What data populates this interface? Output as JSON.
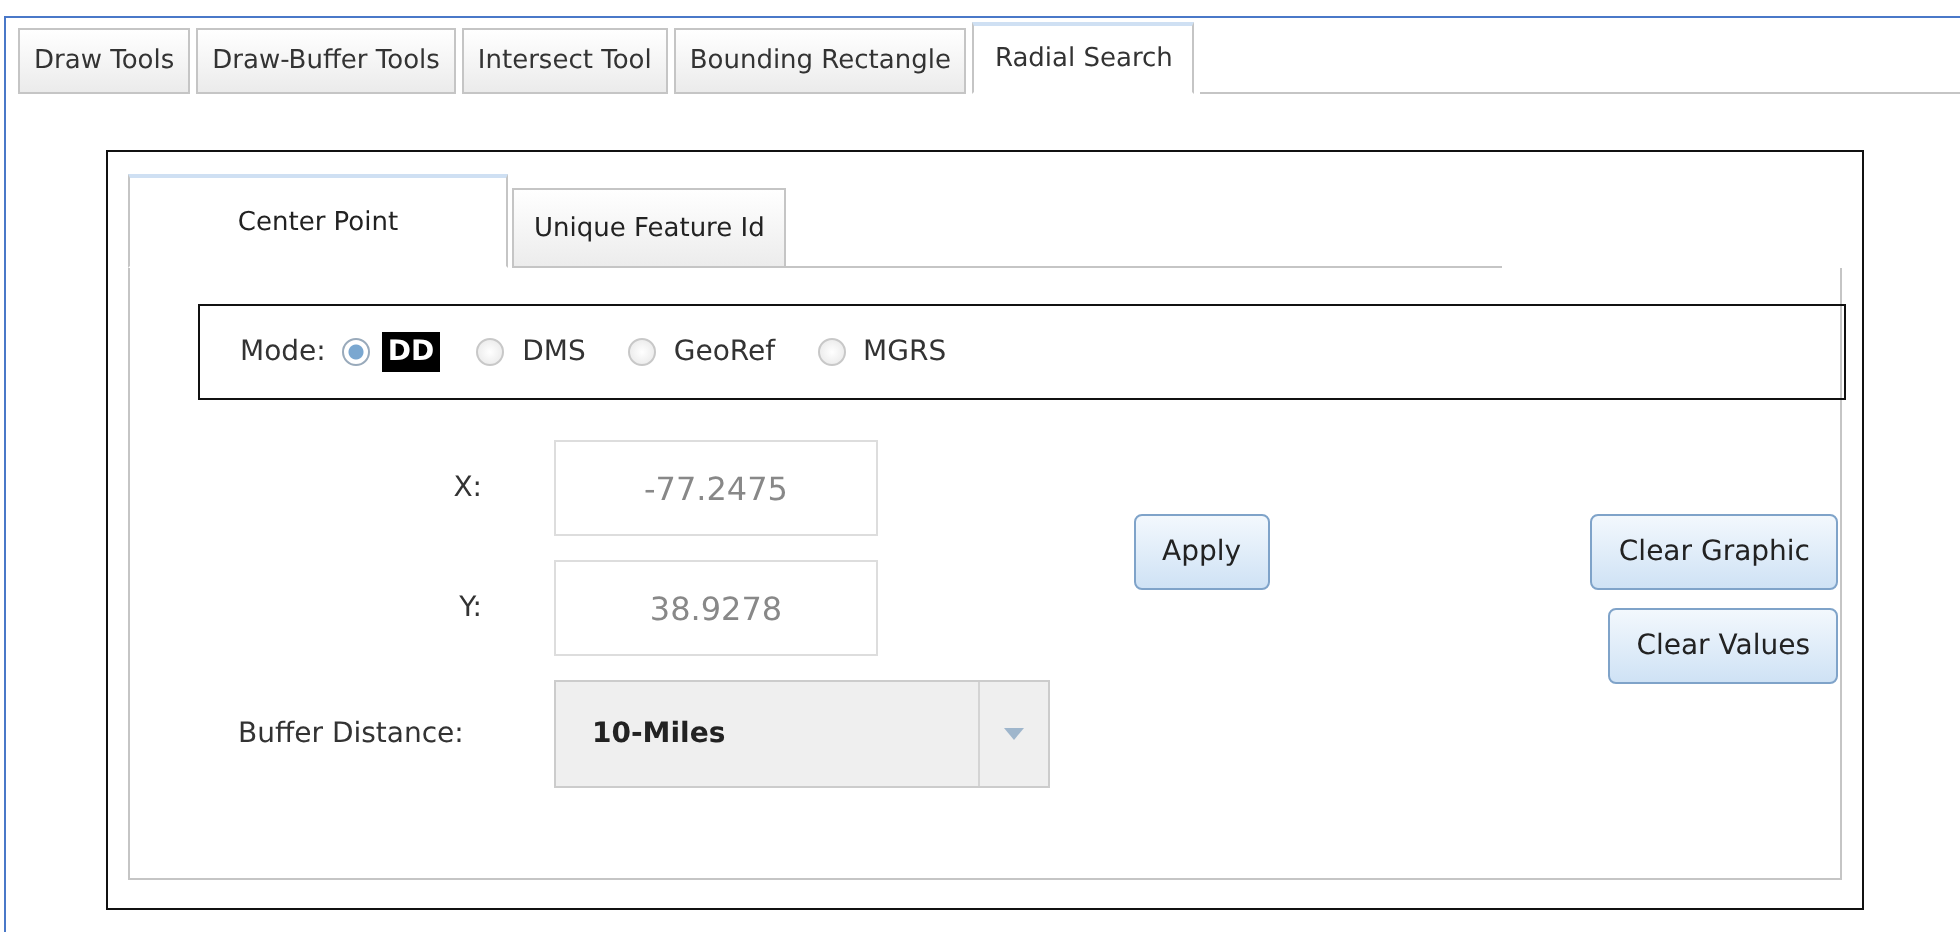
{
  "tabs": [
    {
      "label": "Draw Tools",
      "selected": false
    },
    {
      "label": "Draw-Buffer Tools",
      "selected": false
    },
    {
      "label": "Intersect Tool",
      "selected": false
    },
    {
      "label": "Bounding Rectangle",
      "selected": false
    },
    {
      "label": "Radial Search",
      "selected": true
    }
  ],
  "sub_tabs": [
    {
      "label": "Center Point",
      "selected": true
    },
    {
      "label": "Unique Feature Id",
      "selected": false
    }
  ],
  "mode": {
    "label": "Mode:",
    "options": [
      {
        "label": "DD",
        "selected": true
      },
      {
        "label": "DMS",
        "selected": false
      },
      {
        "label": "GeoRef",
        "selected": false
      },
      {
        "label": "MGRS",
        "selected": false
      }
    ]
  },
  "fields": [
    {
      "label": "X:",
      "value": "-77.2475"
    },
    {
      "label": "Y:",
      "value": "38.9278"
    }
  ],
  "buffer_distance": {
    "label": "Buffer Distance:",
    "value": "10-Miles"
  },
  "buttons": {
    "apply": "Apply",
    "clear_graphic": "Clear Graphic",
    "clear_values": "Clear Values"
  }
}
